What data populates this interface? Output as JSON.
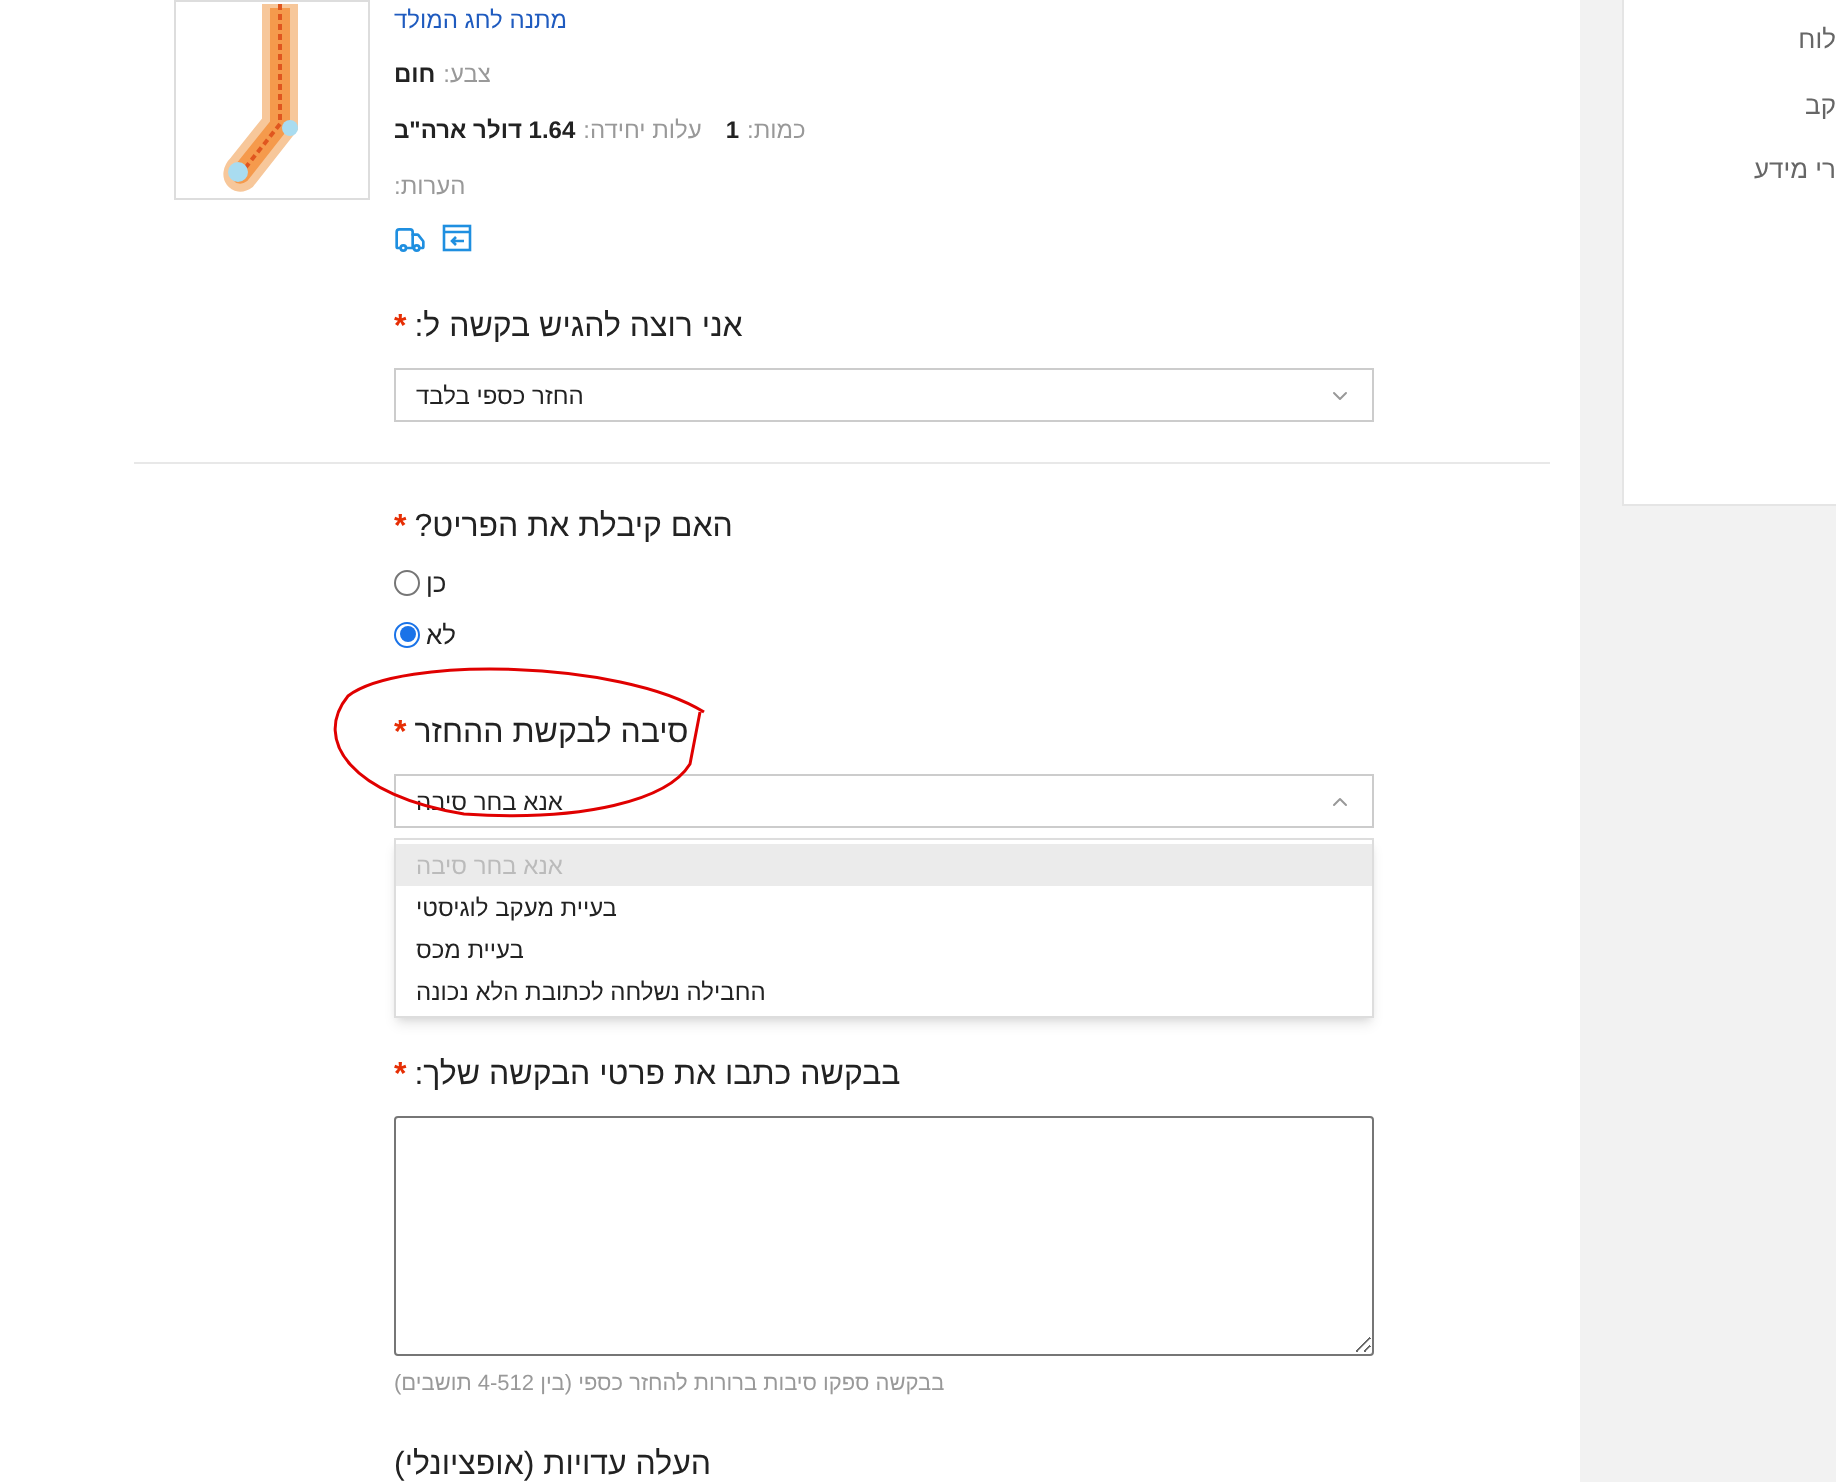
{
  "required_marker": "*",
  "product": {
    "title": "מתנה לחג המולד",
    "color_label": "צבע:",
    "color_value": "חום",
    "quantity_label": "כמות:",
    "quantity": "1",
    "unit_price_label": "עלות יחידה:",
    "unit_price": "1.64 דולר ארה\"ב",
    "notes_label": "הערות:"
  },
  "request_type": {
    "label": "אני רוצה להגיש בקשה ל:",
    "required": true,
    "value": "החזר כספי בלבד",
    "expanded": false
  },
  "received": {
    "label": "האם קיבלת את הפריט?",
    "required": true,
    "options": [
      {
        "label": "כן",
        "selected": false
      },
      {
        "label": "לא",
        "selected": true
      }
    ]
  },
  "reason": {
    "label": "סיבה לבקשת ההחזר",
    "required": true,
    "value": "אנא בחר סיבה",
    "expanded": true,
    "options": [
      {
        "label": "אנא בחר סיבה",
        "disabled": true,
        "selected": true
      },
      {
        "label": "בעיית מעקב לוגיסטי",
        "disabled": false,
        "selected": false
      },
      {
        "label": "בעיית מכס",
        "disabled": false,
        "selected": false
      },
      {
        "label": "החבילה נשלחה לכתובת הלא נכונה",
        "disabled": false,
        "selected": false
      }
    ]
  },
  "details": {
    "label": "בבקשה כתבו את פרטי הבקשה שלך:",
    "required": true,
    "hint": "בבקשה ספקו סיבות ברורות להחזר כספי (בין 4-512 תושבים)"
  },
  "evidence": {
    "label": "העלה עדויות (אופציונלי)",
    "required": false
  },
  "sidebar": {
    "items": [
      "לוח",
      "קב",
      "רי מידע"
    ]
  }
}
